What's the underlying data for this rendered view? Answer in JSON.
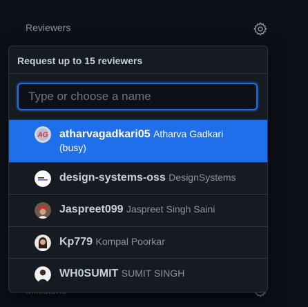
{
  "sidebar": {
    "reviewers_heading": "Reviewers",
    "milestone_heading": "Milestone",
    "settings_icon": "gear-icon"
  },
  "popover": {
    "title": "Request up to 15 reviewers",
    "filter_placeholder": "Type or choose a name",
    "filter_value": ""
  },
  "suggestions": [
    {
      "login": "atharvagadkari05",
      "name": "Atharva Gadkari",
      "status": "(busy)",
      "selected": true
    },
    {
      "login": "design-systems-oss",
      "name": "DesignSystems",
      "selected": false
    },
    {
      "login": "Jaspreet099",
      "name": "Jaspreet Singh Saini",
      "selected": false
    },
    {
      "login": "Kp779",
      "name": "Kompal Poorkar",
      "selected": false
    },
    {
      "login": "WH0SUMIT",
      "name": "SUMIT SINGH",
      "selected": false
    }
  ],
  "colors": {
    "background": "#0d1117",
    "popover": "#161b22",
    "border": "#30363d",
    "accent": "#1f6feb",
    "text": "#c9d1d9",
    "muted": "#8b949e"
  }
}
